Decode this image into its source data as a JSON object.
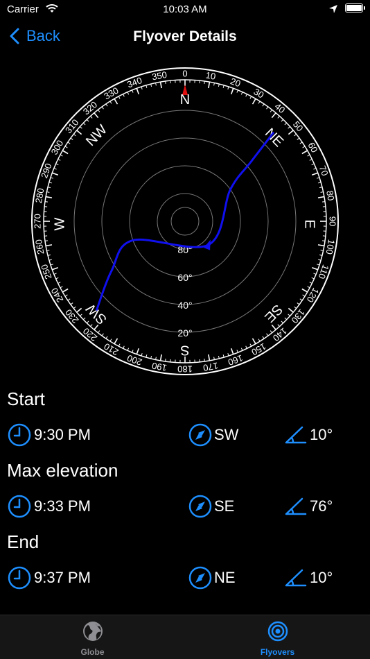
{
  "status_bar": {
    "carrier": "Carrier",
    "time": "10:03 AM"
  },
  "nav": {
    "back_label": "Back",
    "title": "Flyover Details"
  },
  "compass": {
    "cardinal": {
      "n": "N",
      "ne": "NE",
      "e": "E",
      "se": "SE",
      "s": "S",
      "sw": "SW",
      "w": "W",
      "nw": "NW"
    },
    "elevation_rings": [
      {
        "value": 80,
        "label": "80°"
      },
      {
        "value": 60,
        "label": "60°"
      },
      {
        "value": 40,
        "label": "40°"
      },
      {
        "value": 20,
        "label": "20°"
      }
    ],
    "degree_labels": [
      "0",
      "10",
      "20",
      "30",
      "40",
      "50",
      "60",
      "70",
      "80",
      "90",
      "100",
      "110",
      "120",
      "130",
      "140",
      "150",
      "160",
      "170",
      "180",
      "190",
      "200",
      "210",
      "220",
      "230",
      "240",
      "250",
      "260",
      "270",
      "280",
      "290",
      "300",
      "310",
      "320",
      "330",
      "340",
      "350"
    ],
    "path_points": [
      {
        "azimuth": 225,
        "elevation": 10
      },
      {
        "azimuth": 236,
        "elevation": 36
      },
      {
        "azimuth": 250,
        "elevation": 60
      },
      {
        "azimuth": 135,
        "elevation": 76
      },
      {
        "azimuth": 55,
        "elevation": 60
      },
      {
        "azimuth": 48,
        "elevation": 36
      },
      {
        "azimuth": 45,
        "elevation": 10
      }
    ],
    "path_color": "#1010ee",
    "north_marker_color": "#e01010"
  },
  "sections": {
    "start": {
      "title": "Start",
      "time": "9:30 PM",
      "direction": "SW",
      "elevation": "10°"
    },
    "max": {
      "title": "Max elevation",
      "time": "9:33 PM",
      "direction": "SE",
      "elevation": "76°"
    },
    "end": {
      "title": "End",
      "time": "9:37 PM",
      "direction": "NE",
      "elevation": "10°"
    }
  },
  "tabs": {
    "globe": {
      "label": "Globe",
      "icon": "globe-icon"
    },
    "flyovers": {
      "label": "Flyovers",
      "icon": "target-icon",
      "selected": true
    }
  },
  "colors": {
    "accent": "#1e8fff",
    "background": "#000000",
    "tab_bar": "#161616",
    "inactive_tab": "#8e8e93"
  }
}
